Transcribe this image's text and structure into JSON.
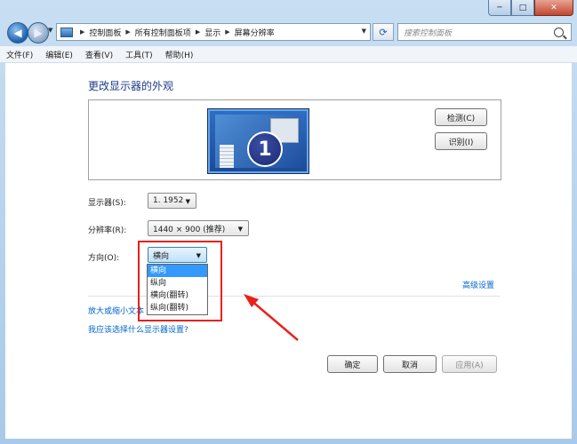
{
  "address": {
    "crumbs": [
      "控制面板",
      "所有控制面板项",
      "显示",
      "屏幕分辨率"
    ],
    "search_placeholder": "搜索控制面板"
  },
  "caption": {
    "minimize": "─",
    "maximize": "□",
    "close": "✕"
  },
  "menu": [
    "文件(F)",
    "编辑(E)",
    "查看(V)",
    "工具(T)",
    "帮助(H)"
  ],
  "main": {
    "title": "更改显示器的外观",
    "monitor_number": "1",
    "detect_label": "检测(C)",
    "identify_label": "识别(I)",
    "display_label": "显示器(S):",
    "display_value": "1. 1952",
    "resolution_label": "分辨率(R):",
    "resolution_value": "1440 × 900 (推荐)",
    "orientation_label": "方向(O):",
    "orientation_value": "横向",
    "orientation_options": [
      "横向",
      "纵向",
      "横向(翻转)",
      "纵向(翻转)"
    ],
    "advanced_link": "高级设置",
    "enlarge_link": "放大或缩小文本",
    "which_settings_link": "我应该选择什么显示器设置?",
    "ok_label": "确定",
    "cancel_label": "取消",
    "apply_label": "应用(A)"
  },
  "colors": {
    "highlight": "#e8211b",
    "link": "#0066cc",
    "selected": "#3399ff"
  }
}
